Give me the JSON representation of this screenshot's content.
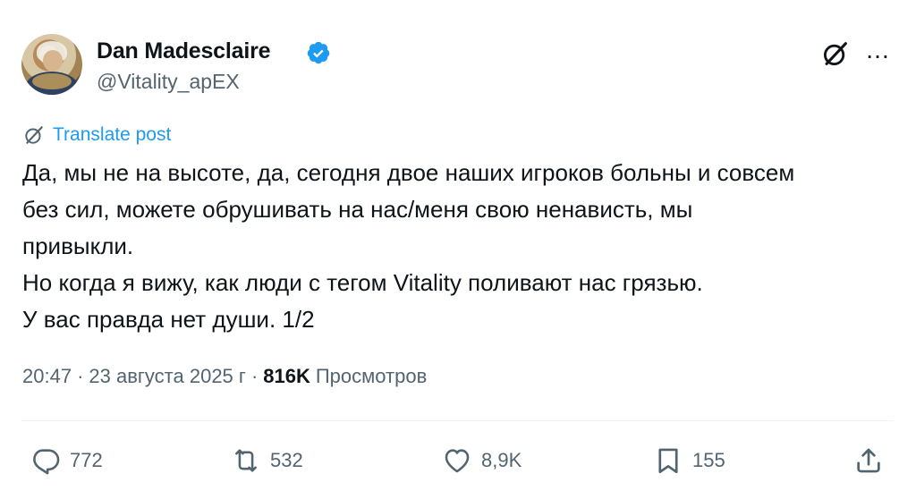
{
  "author": {
    "name": "Dan Madesclaire",
    "handle": "@Vitality_apEX",
    "verified": true,
    "verified_color": "#1d9bf0"
  },
  "header_icons": {
    "grok": "grok-slash-icon",
    "more": "…"
  },
  "translate": {
    "label": "Translate post",
    "icon": "grok-slash-icon"
  },
  "post": {
    "lines": [
      "Да, мы не на высоте, да, сегодня двое наших игроков больны и совсем",
      "без сил, можете обрушивать на нас/меня свою ненависть, мы",
      "привыкли.",
      "Но когда я вижу, как люди с тегом Vitality поливают нас грязью.",
      "У вас правда нет души. 1/2"
    ]
  },
  "meta": {
    "time": "20:47",
    "sep1": "·",
    "date": "23 августа 2025 г",
    "sep2": "·",
    "views_count": "816K",
    "views_label": "Просмотров"
  },
  "actions": {
    "reply": {
      "icon": "reply-icon",
      "count": "772"
    },
    "retweet": {
      "icon": "retweet-icon",
      "count": "532"
    },
    "like": {
      "icon": "heart-icon",
      "count": "8,9K"
    },
    "bookmark": {
      "icon": "bookmark-icon",
      "count": "155"
    },
    "share": {
      "icon": "share-icon"
    }
  },
  "colors": {
    "text": "#0f1419",
    "secondary": "#536471",
    "accent": "#1d9bf0",
    "divider": "#eff3f4"
  }
}
